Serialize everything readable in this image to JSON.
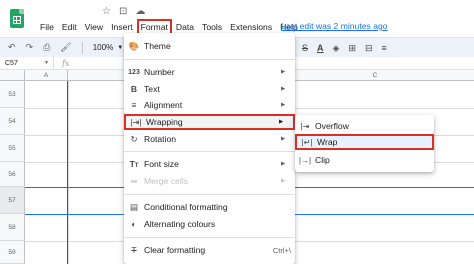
{
  "menubar": {
    "items": [
      "File",
      "Edit",
      "View",
      "Insert",
      "Format",
      "Data",
      "Tools",
      "Extensions",
      "Help"
    ],
    "active_index": 4,
    "last_edit": "Last edit was 2 minutes ago"
  },
  "toolbar": {
    "zoom": "100%",
    "font_size_letter": "A"
  },
  "formula_bar": {
    "name_box": "C57",
    "fx": "fx"
  },
  "grid": {
    "columns": [
      "A",
      "C"
    ],
    "rows": [
      "53",
      "54",
      "55",
      "56",
      "57",
      "58",
      "59"
    ]
  },
  "format_menu": {
    "theme": "Theme",
    "number": "Number",
    "text": "Text",
    "alignment": "Alignment",
    "wrapping": "Wrapping",
    "rotation": "Rotation",
    "font_size": "Font size",
    "merge_cells": "Merge cells",
    "conditional_formatting": "Conditional formatting",
    "alternating_colours": "Alternating colours",
    "clear_formatting": "Clear formatting",
    "clear_formatting_shortcut": "Ctrl+\\"
  },
  "wrapping_submenu": {
    "overflow": "Overflow",
    "wrap": "Wrap",
    "clip": "Clip"
  },
  "colors": {
    "highlight_border": "#d93025",
    "accent_blue": "#1a73e8",
    "sheets_green": "#23a566"
  }
}
